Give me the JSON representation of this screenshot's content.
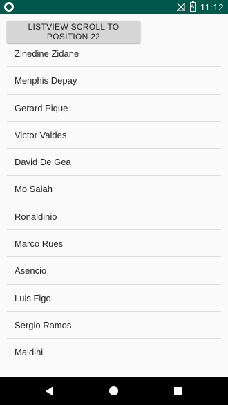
{
  "status_bar": {
    "time": "11:12",
    "battery_level": "",
    "icons": [
      "app-status-icon",
      "no-signal-icon",
      "battery-icon"
    ]
  },
  "toolbar": {
    "scroll_button_label": "LISTVIEW SCROLL TO POSITION 22"
  },
  "list": {
    "items": [
      {
        "label": "Zinedine Zidane"
      },
      {
        "label": "Menphis Depay"
      },
      {
        "label": "Gerard Pique"
      },
      {
        "label": "Victor Valdes"
      },
      {
        "label": "David De Gea"
      },
      {
        "label": "Mo Salah"
      },
      {
        "label": "Ronaldinio"
      },
      {
        "label": "Marco Rues"
      },
      {
        "label": "Asencio"
      },
      {
        "label": "Luis Figo"
      },
      {
        "label": "Sergio Ramos"
      },
      {
        "label": "Maldini"
      }
    ]
  },
  "nav_bar": {
    "icons": [
      "back-icon",
      "home-icon",
      "recents-icon"
    ]
  },
  "colors": {
    "status_bar": "#00574b",
    "button": "#d6d6d6",
    "background": "#fafafa",
    "nav_bar": "#000000"
  }
}
